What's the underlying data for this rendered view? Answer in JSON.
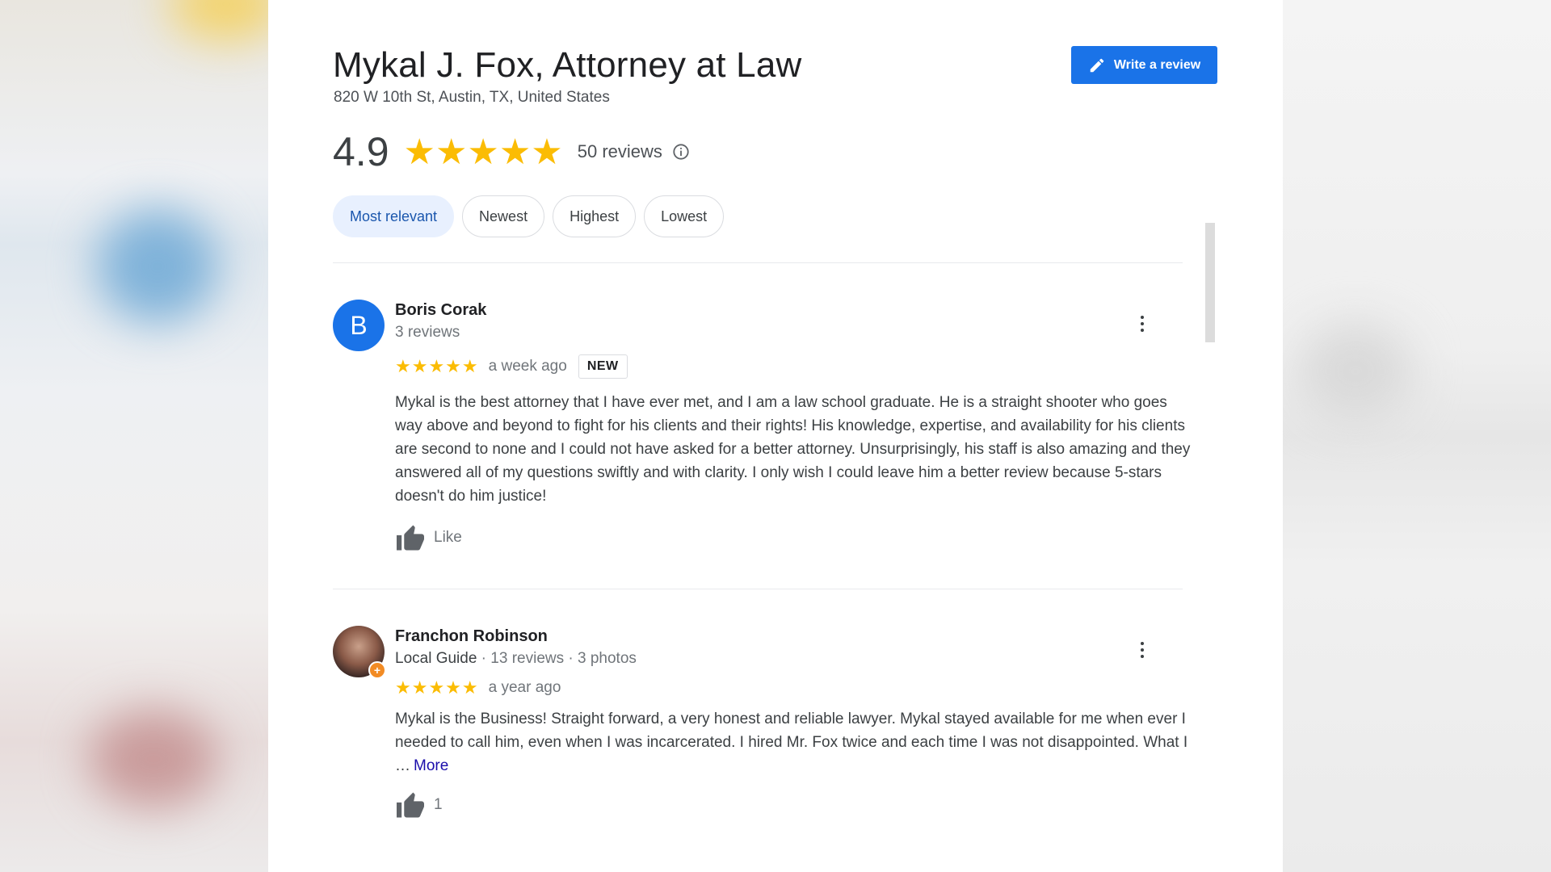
{
  "business": {
    "name": "Mykal J. Fox, Attorney at Law",
    "address": "820 W 10th St, Austin, TX, United States",
    "rating": "4.9",
    "stars": "★★★★★",
    "review_count": "50 reviews"
  },
  "actions": {
    "write_review_label": "Write a review"
  },
  "sort_chips": [
    {
      "label": "Most relevant",
      "active": true
    },
    {
      "label": "Newest"
    },
    {
      "label": "Highest"
    },
    {
      "label": "Lowest"
    }
  ],
  "reviews": [
    {
      "avatar_letter": "B",
      "name": "Boris Corak",
      "meta": "3 reviews",
      "stars": "★★★★★",
      "date": "a week ago",
      "badge": "NEW",
      "text": "Mykal is the best attorney that I have ever met, and I am a law school graduate. He is a straight shooter who goes way above and beyond to fight for his clients and their rights! His knowledge, expertise, and availability for his clients are second to none and I could not have asked for a better attorney. Unsurprisingly, his staff is also amazing and they answered all of my questions swiftly and with clarity. I only wish I could leave him a better review because 5-stars doesn't do him justice!",
      "like_label": "Like"
    },
    {
      "name": "Franchon Robinson",
      "guide_label": "Local Guide",
      "meta": " · 13 reviews · 3 photos",
      "stars": "★★★★★",
      "date": "a year ago",
      "text": "Mykal is the Business! Straight forward, a very honest and reliable lawyer. Mykal stayed available for me when ever I needed to call him, even when I was incarcerated. I hired Mr. Fox twice and each time I was not disappointed. What I …",
      "more_label": "More",
      "like_count": "1"
    }
  ],
  "colors": {
    "accent": "#1a73e8",
    "star": "#fbbc04",
    "chip_active_bg": "#e8f0fe"
  }
}
